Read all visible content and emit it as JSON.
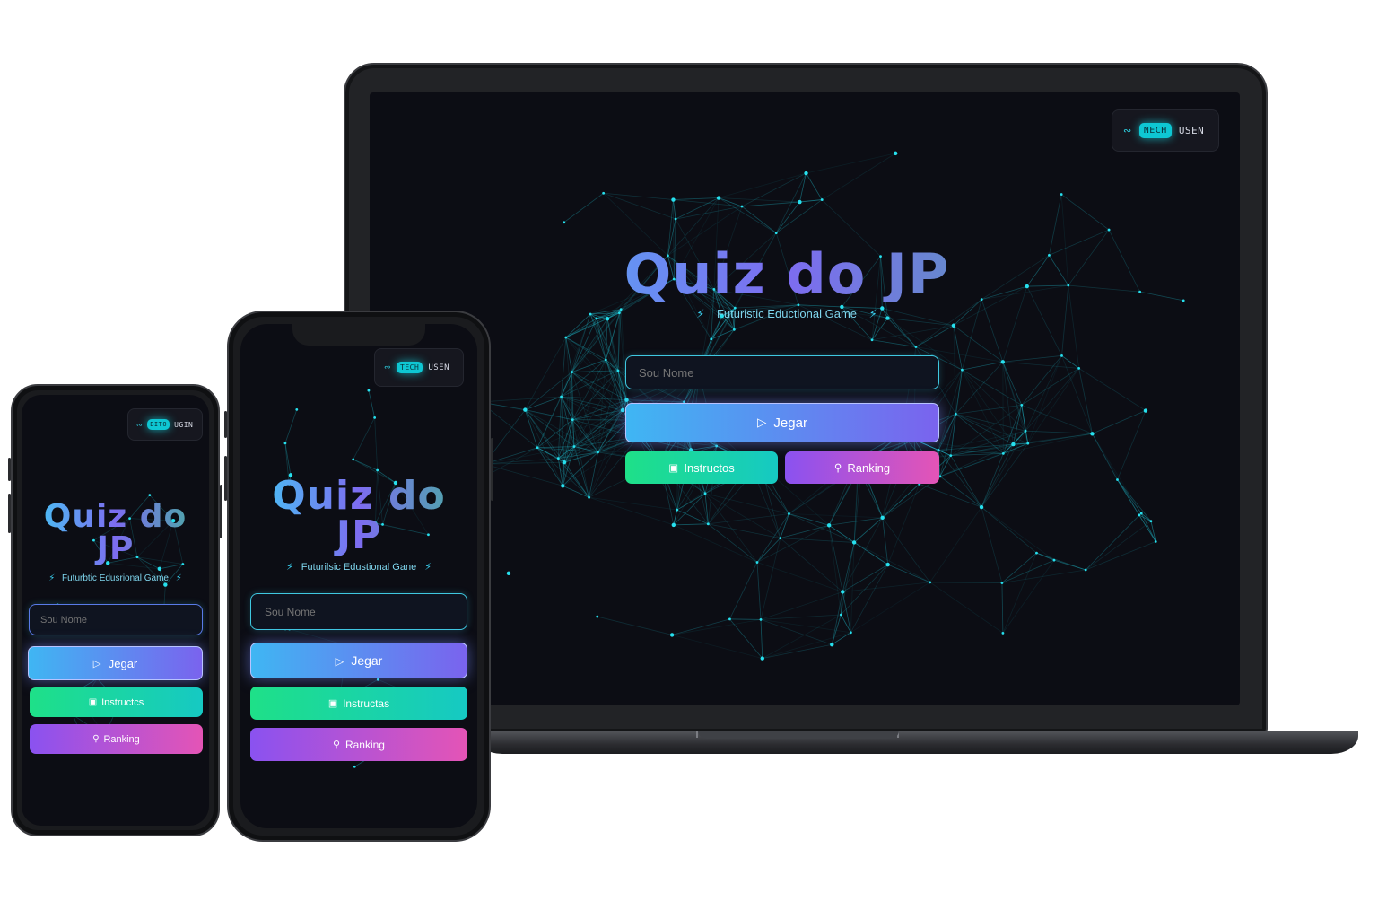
{
  "laptop": {
    "user_chip": {
      "icon": "link-icon",
      "badge": "NECH",
      "label": "USEN"
    },
    "title": "Quiz do JP",
    "subtitle": "Futuristic Eductional Game",
    "name_placeholder": "Sou Nome",
    "play_label": "Jegar",
    "instructions_label": "Instructos",
    "ranking_label": "Ranking"
  },
  "phone_small": {
    "user_chip": {
      "icon": "link-icon",
      "badge": "BITO",
      "label": "UGIN"
    },
    "title_line1": "Quiz do",
    "title_line2": "JP",
    "subtitle": "Futurbtic Edusrional Game",
    "name_placeholder": "Sou Nome",
    "play_label": "Jegar",
    "instructions_label": "Instructcs",
    "ranking_label": "Ranking"
  },
  "phone_large": {
    "user_chip": {
      "icon": "link-icon",
      "badge": "TECH",
      "label": "USEN"
    },
    "title_line1": "Quiz do",
    "title_line2": "JP",
    "subtitle": "Futurilsic Edustional Gane",
    "name_placeholder": "Sou Nome",
    "play_label": "Jegar",
    "instructions_label": "Instructas",
    "ranking_label": "Ranking"
  },
  "icons": {
    "play": "play-icon",
    "instructions": "book-icon",
    "ranking": "trophy-icon",
    "bolt": "lightning-icon"
  },
  "colors": {
    "screen_bg": "#0c0d14",
    "network_line": "#1fb8c8",
    "accent_cyan": "#0ec7d3",
    "play_gradient": [
      "#3fb6f3",
      "#7a63ee"
    ],
    "instructions_gradient": [
      "#1ee088",
      "#16c9c3"
    ],
    "ranking_gradient": [
      "#8a52f0",
      "#e454b6"
    ]
  }
}
